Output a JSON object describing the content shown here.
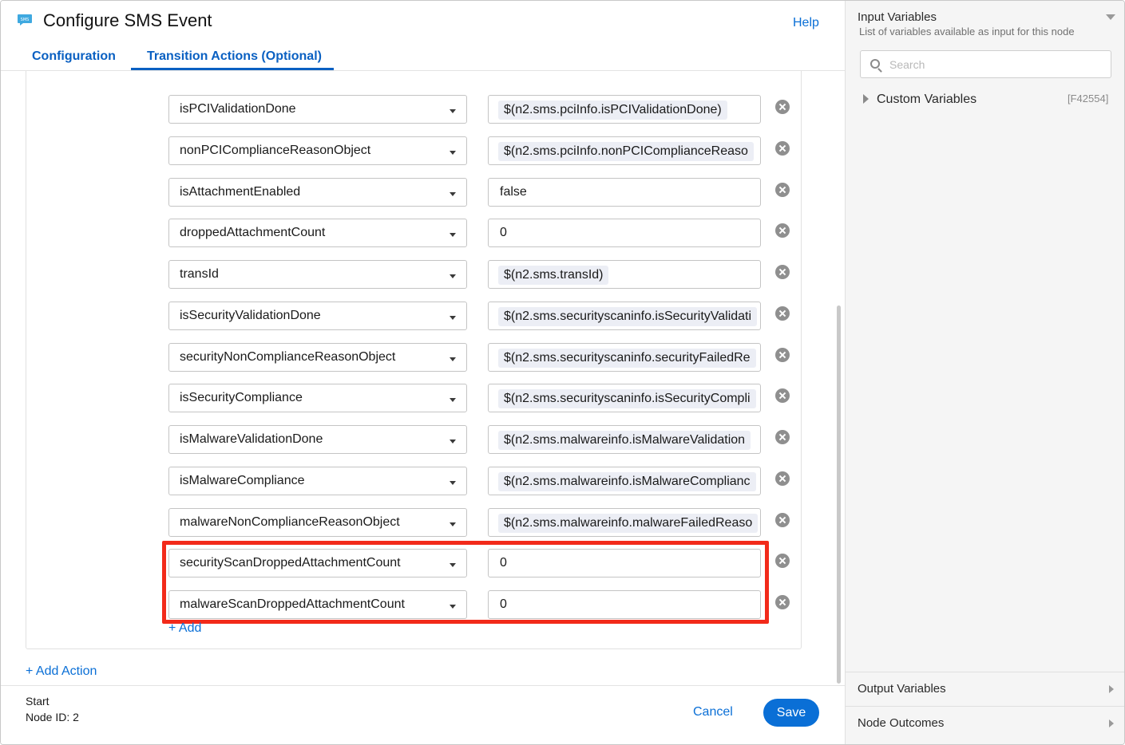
{
  "header": {
    "title": "Configure SMS Event",
    "help_label": "Help",
    "tabs": [
      {
        "label": "Configuration"
      },
      {
        "label": "Transition Actions (Optional)"
      }
    ]
  },
  "rows": [
    {
      "variable": "isPCIValidationDone",
      "value": "$(n2.sms.pciInfo.isPCIValidationDone)",
      "value_is_expression": true
    },
    {
      "variable": "nonPCIComplianceReasonObject",
      "value": "$(n2.sms.pciInfo.nonPCIComplianceReaso",
      "value_is_expression": true
    },
    {
      "variable": "isAttachmentEnabled",
      "value": "false",
      "value_is_expression": false
    },
    {
      "variable": "droppedAttachmentCount",
      "value": "0",
      "value_is_expression": false
    },
    {
      "variable": "transId",
      "value": "$(n2.sms.transId)",
      "value_is_expression": true
    },
    {
      "variable": "isSecurityValidationDone",
      "value": "$(n2.sms.securityscaninfo.isSecurityValidati",
      "value_is_expression": true
    },
    {
      "variable": "securityNonComplianceReasonObject",
      "value": "$(n2.sms.securityscaninfo.securityFailedRe",
      "value_is_expression": true
    },
    {
      "variable": "isSecurityCompliance",
      "value": "$(n2.sms.securityscaninfo.isSecurityCompli",
      "value_is_expression": true
    },
    {
      "variable": "isMalwareValidationDone",
      "value": "$(n2.sms.malwareinfo.isMalwareValidation",
      "value_is_expression": true
    },
    {
      "variable": "isMalwareCompliance",
      "value": "$(n2.sms.malwareinfo.isMalwareComplianc",
      "value_is_expression": true
    },
    {
      "variable": "malwareNonComplianceReasonObject",
      "value": "$(n2.sms.malwareinfo.malwareFailedReaso",
      "value_is_expression": true
    },
    {
      "variable": "securityScanDroppedAttachmentCount",
      "value": "0",
      "value_is_expression": false
    },
    {
      "variable": "malwareScanDroppedAttachmentCount",
      "value": "0",
      "value_is_expression": false
    }
  ],
  "actions": {
    "add_label": "+ Add",
    "add_action_label": "+ Add Action"
  },
  "footer": {
    "node_name": "Start",
    "node_id": "Node ID: 2",
    "cancel_label": "Cancel",
    "save_label": "Save"
  },
  "side_panel": {
    "title": "Input Variables",
    "subtitle": "List of variables available as input for this node",
    "search_placeholder": "Search",
    "tree": [
      {
        "label": "Custom Variables",
        "code": "[F42554]"
      }
    ],
    "sections": [
      {
        "label": "Output Variables"
      },
      {
        "label": "Node Outcomes"
      }
    ]
  },
  "colors": {
    "accent": "#0a6fd6",
    "highlight": "#f22a1a",
    "chip": "#eceef5"
  }
}
